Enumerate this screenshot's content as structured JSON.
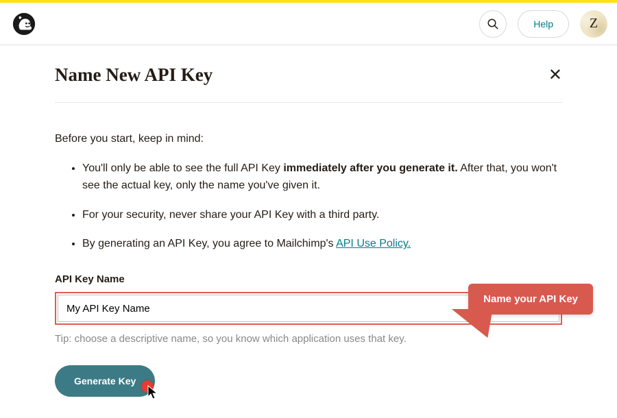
{
  "header": {
    "help_label": "Help",
    "avatar_letter": "Z"
  },
  "page": {
    "title": "Name New API Key",
    "intro": "Before you start, keep in mind:",
    "bullets": {
      "b1a": "You'll only be able to see the full API Key ",
      "b1b": "immediately after you generate it.",
      "b1c": " After that, you won't see the actual key, only the name you've given it.",
      "b2": "For your security, never share your API Key with a third party.",
      "b3a": "By generating an API Key, you agree to Mailchimp's ",
      "b3b": "API Use Policy."
    },
    "field_label": "API Key Name",
    "input_value": "My API Key Name",
    "tip": "Tip: choose a descriptive name, so you know which application uses that key.",
    "generate_label": "Generate Key"
  },
  "callout": {
    "text": "Name your API Key"
  }
}
